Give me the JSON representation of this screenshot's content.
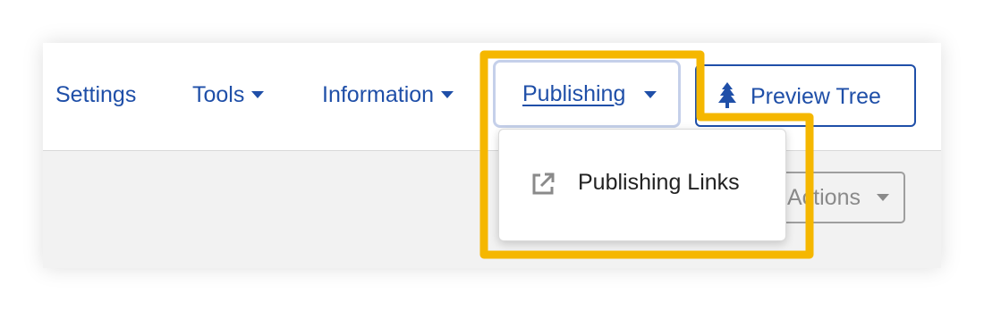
{
  "nav": {
    "settings_label": "Settings",
    "tools_label": "Tools",
    "information_label": "Information",
    "publishing_label": "Publishing",
    "preview_tree_label": "Preview Tree"
  },
  "content": {
    "actions_label": "Actions"
  },
  "dropdown": {
    "items": [
      {
        "label": "Publishing Links",
        "icon": "external-link-icon"
      }
    ]
  },
  "colors": {
    "link": "#1f4fa8",
    "highlight": "#f5b700",
    "content_bg": "#f2f2f2"
  },
  "icons": {
    "preview_tree": "tree-icon",
    "dropdown_caret": "caret-down-icon"
  }
}
